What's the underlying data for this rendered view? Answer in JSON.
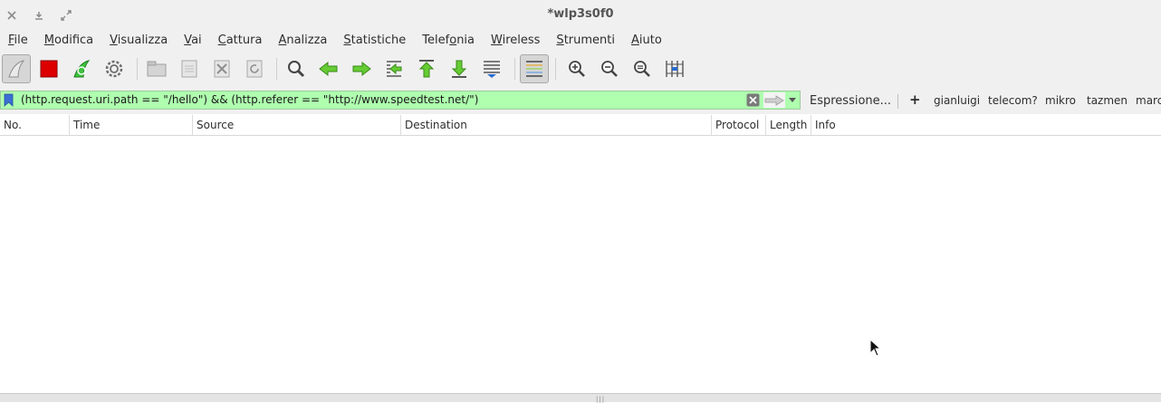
{
  "window": {
    "title": "*wlp3s0f0",
    "controls": [
      "close-icon",
      "minimize-icon",
      "restore-icon"
    ]
  },
  "menu": [
    {
      "label": "File",
      "mnemonic": "F",
      "rest": "ile"
    },
    {
      "label": "Modifica",
      "mnemonic": "M",
      "rest": "odifica"
    },
    {
      "label": "Visualizza",
      "mnemonic": "V",
      "rest": "isualizza"
    },
    {
      "label": "Vai",
      "mnemonic": "V",
      "rest": "ai"
    },
    {
      "label": "Cattura",
      "mnemonic": "C",
      "rest": "attura"
    },
    {
      "label": "Analizza",
      "mnemonic": "A",
      "rest": "nalizza"
    },
    {
      "label": "Statistiche",
      "mnemonic": "S",
      "rest": "tatistiche"
    },
    {
      "label": "Telefonia",
      "pre": "Telef",
      "mnemonic": "o",
      "rest": "nia"
    },
    {
      "label": "Wireless",
      "mnemonic": "W",
      "rest": "ireless"
    },
    {
      "label": "Strumenti",
      "mnemonic": "S",
      "rest": "trumenti"
    },
    {
      "label": "Aiuto",
      "mnemonic": "A",
      "rest": "iuto"
    }
  ],
  "toolbar": {
    "icons": [
      "start-capture-icon",
      "stop-capture-icon",
      "restart-capture-icon",
      "capture-options-icon",
      "open-file-icon",
      "save-file-icon",
      "close-file-icon",
      "reload-file-icon",
      "find-packet-icon",
      "go-back-icon",
      "go-forward-icon",
      "go-to-packet-icon",
      "first-packet-icon",
      "last-packet-icon",
      "auto-scroll-icon",
      "colorize-icon",
      "zoom-in-icon",
      "zoom-out-icon",
      "normal-size-icon",
      "resize-columns-icon"
    ],
    "accent": "#28a828",
    "stop_color": "#dd0000"
  },
  "filter": {
    "value": "(http.request.uri.path == \"/hello\") && (http.referer == \"http://www.speedtest.net/\")",
    "background": "#afffaf",
    "expression_label": "Espressione...",
    "add_label": "+",
    "buttons": [
      "gianluigi",
      "telecom?",
      "mikro",
      "tazmen",
      "marc"
    ]
  },
  "columns": [
    "No.",
    "Time",
    "Source",
    "Destination",
    "Protocol",
    "Length",
    "Info"
  ]
}
